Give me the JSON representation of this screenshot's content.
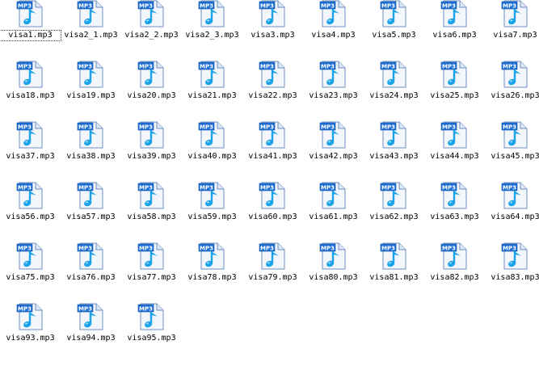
{
  "colors": {
    "icon_blue": "#1d6fd6",
    "note_cyan": "#1aa3e8",
    "page_fill": "#f2f6fb",
    "text": "#000000"
  },
  "icon": {
    "name": "mp3-file-icon",
    "badge_text": "MP3"
  },
  "files": [
    {
      "name": "visa1.mp3",
      "selected": true
    },
    {
      "name": "visa2_1.mp3"
    },
    {
      "name": "visa2_2.mp3"
    },
    {
      "name": "visa2_3.mp3"
    },
    {
      "name": "visa3.mp3"
    },
    {
      "name": "visa4.mp3"
    },
    {
      "name": "visa5.mp3"
    },
    {
      "name": "visa6.mp3"
    },
    {
      "name": "visa7.mp3"
    },
    {
      "name": "visa18.mp3"
    },
    {
      "name": "visa19.mp3"
    },
    {
      "name": "visa20.mp3"
    },
    {
      "name": "visa21.mp3"
    },
    {
      "name": "visa22.mp3"
    },
    {
      "name": "visa23.mp3"
    },
    {
      "name": "visa24.mp3"
    },
    {
      "name": "visa25.mp3"
    },
    {
      "name": "visa26.mp3"
    },
    {
      "name": "visa37.mp3"
    },
    {
      "name": "visa38.mp3"
    },
    {
      "name": "visa39.mp3"
    },
    {
      "name": "visa40.mp3"
    },
    {
      "name": "visa41.mp3"
    },
    {
      "name": "visa42.mp3"
    },
    {
      "name": "visa43.mp3"
    },
    {
      "name": "visa44.mp3"
    },
    {
      "name": "visa45.mp3"
    },
    {
      "name": "visa56.mp3"
    },
    {
      "name": "visa57.mp3"
    },
    {
      "name": "visa58.mp3"
    },
    {
      "name": "visa59.mp3"
    },
    {
      "name": "visa60.mp3"
    },
    {
      "name": "visa61.mp3"
    },
    {
      "name": "visa62.mp3"
    },
    {
      "name": "visa63.mp3"
    },
    {
      "name": "visa64.mp3"
    },
    {
      "name": "visa75.mp3"
    },
    {
      "name": "visa76.mp3"
    },
    {
      "name": "visa77.mp3"
    },
    {
      "name": "visa78.mp3"
    },
    {
      "name": "visa79.mp3"
    },
    {
      "name": "visa80.mp3"
    },
    {
      "name": "visa81.mp3"
    },
    {
      "name": "visa82.mp3"
    },
    {
      "name": "visa83.mp3"
    },
    {
      "name": "visa93.mp3"
    },
    {
      "name": "visa94.mp3"
    },
    {
      "name": "visa95.mp3"
    }
  ]
}
